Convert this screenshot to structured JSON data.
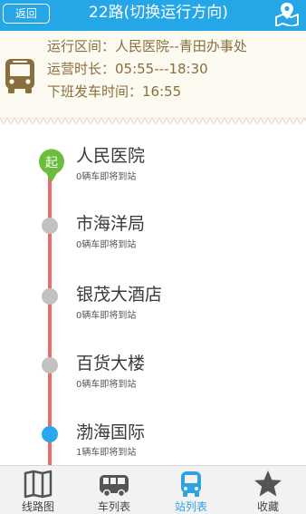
{
  "header": {
    "back_label": "返回",
    "title": "22路(切换运行方向)"
  },
  "info": {
    "range": "运行区间：人民医院--青田办事处",
    "hours": "运营时长：05:55---18:30",
    "last_departure": "下班发车时间：16:55"
  },
  "start_badge": "起",
  "stops": [
    {
      "name": "人民医院",
      "status": "0辆车即将到站",
      "active": false
    },
    {
      "name": "市海洋局",
      "status": "0辆车即将到站",
      "active": false
    },
    {
      "name": "银茂大酒店",
      "status": "0辆车即将到站",
      "active": false
    },
    {
      "name": "百货大楼",
      "status": "0辆车即将到站",
      "active": false
    },
    {
      "name": "渤海国际",
      "status": "1辆车即将到站",
      "active": true
    }
  ],
  "nav": [
    {
      "label": "线路图",
      "icon": "map-book-icon",
      "active": false
    },
    {
      "label": "车列表",
      "icon": "bus-list-icon",
      "active": false
    },
    {
      "label": "站列表",
      "icon": "bus-stop-list-icon",
      "active": true
    },
    {
      "label": "收藏",
      "icon": "star-icon",
      "active": false
    }
  ],
  "colors": {
    "header": "#25a6e6",
    "info_text": "#8a6f3e",
    "route_line": "#ef6a6a",
    "start_badge": "#6bbd3c",
    "active_dot": "#28a9ee",
    "inactive_dot": "#c2c2c2",
    "nav_active": "#2fa3e0"
  }
}
